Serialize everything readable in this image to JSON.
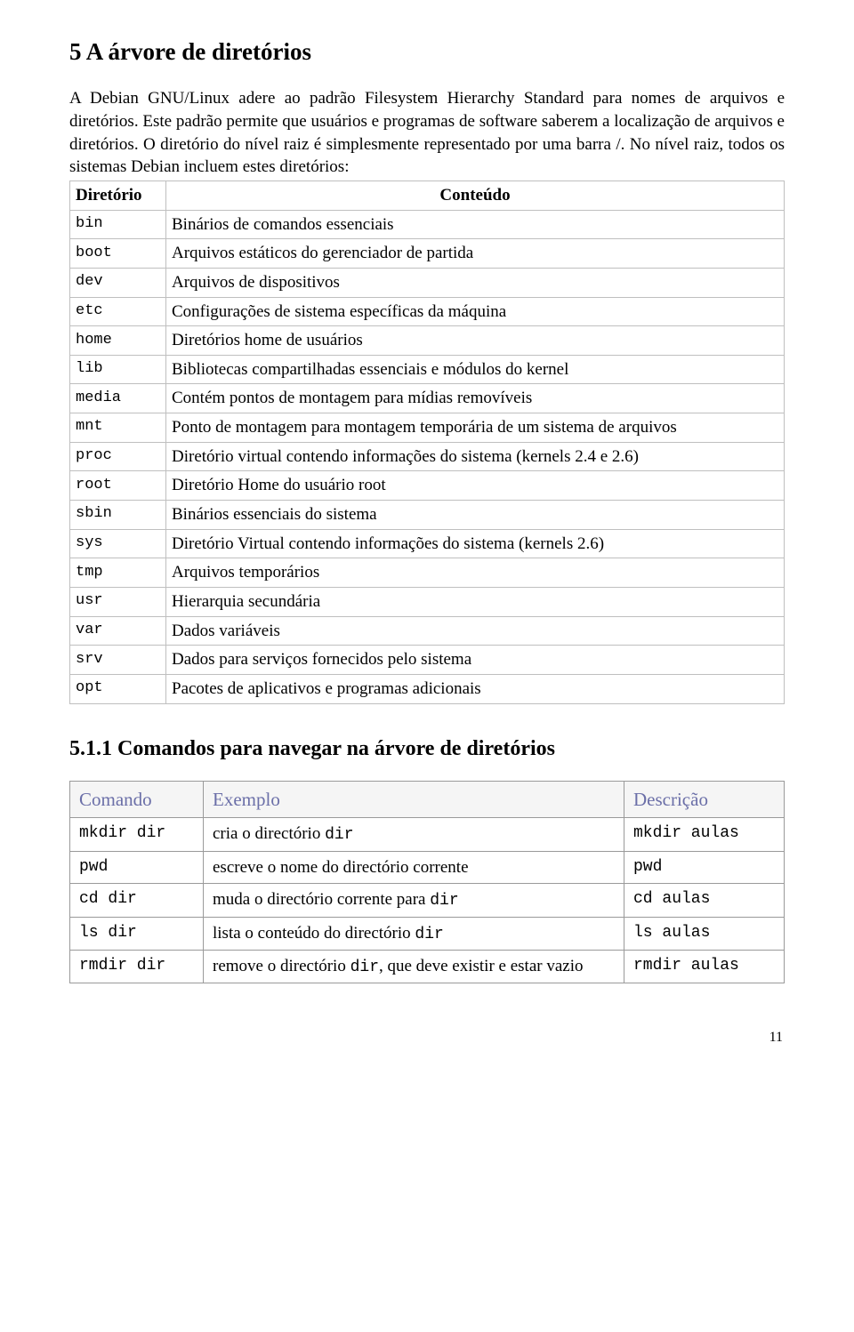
{
  "section": {
    "title": "5 A árvore de diretórios",
    "paragraph": "A Debian GNU/Linux adere ao padrão Filesystem Hierarchy Standard para nomes de arquivos e diretórios. Este padrão permite que usuários e programas de software saberem a localização de arquivos e diretórios. O diretório do nível raiz é simplesmente representado por uma barra /. No nível raiz, todos os sistemas Debian incluem estes diretórios:"
  },
  "dirTable": {
    "headers": {
      "col1": "Diretório",
      "col2": "Conteúdo"
    },
    "rows": [
      {
        "dir": "bin",
        "desc": "Binários de comandos essenciais"
      },
      {
        "dir": "boot",
        "desc": "Arquivos estáticos do gerenciador de partida"
      },
      {
        "dir": "dev",
        "desc": "Arquivos de dispositivos"
      },
      {
        "dir": "etc",
        "desc": "Configurações de sistema específicas da máquina"
      },
      {
        "dir": "home",
        "desc": "Diretórios home de usuários"
      },
      {
        "dir": "lib",
        "desc": "Bibliotecas compartilhadas essenciais e módulos do kernel"
      },
      {
        "dir": "media",
        "desc": "Contém pontos de montagem para mídias removíveis"
      },
      {
        "dir": "mnt",
        "desc": "Ponto de montagem para montagem temporária de um sistema de arquivos"
      },
      {
        "dir": "proc",
        "desc": "Diretório virtual contendo informações do sistema (kernels 2.4 e 2.6)"
      },
      {
        "dir": "root",
        "desc": "Diretório Home do usuário root"
      },
      {
        "dir": "sbin",
        "desc": "Binários essenciais do sistema"
      },
      {
        "dir": "sys",
        "desc": "Diretório Virtual contendo informações do sistema (kernels 2.6)"
      },
      {
        "dir": "tmp",
        "desc": "Arquivos temporários"
      },
      {
        "dir": "usr",
        "desc": "Hierarquia secundária"
      },
      {
        "dir": "var",
        "desc": "Dados variáveis"
      },
      {
        "dir": "srv",
        "desc": "Dados para serviços fornecidos pelo sistema"
      },
      {
        "dir": "opt",
        "desc": "Pacotes de aplicativos e programas adicionais"
      }
    ]
  },
  "subsection": {
    "title": "5.1.1 Comandos para navegar na árvore de diretórios"
  },
  "cmdTable": {
    "headers": {
      "col1": "Comando",
      "col2": "Exemplo",
      "col3": "Descrição"
    },
    "rows": [
      {
        "cmd": "mkdir dir",
        "ex_plain": "cria o directório ",
        "ex_mono": "dir",
        "desc": "mkdir aulas"
      },
      {
        "cmd": "pwd",
        "ex_plain": "escreve o nome do directório corrente",
        "ex_mono": "",
        "desc": "pwd"
      },
      {
        "cmd": "cd dir",
        "ex_plain": "muda o directório corrente para ",
        "ex_mono": "dir",
        "desc": "cd aulas"
      },
      {
        "cmd": "ls dir",
        "ex_plain": "lista o conteúdo do directório ",
        "ex_mono": "dir",
        "desc": "ls aulas"
      },
      {
        "cmd": "rmdir dir",
        "ex_plain": "remove o directório ",
        "ex_mono": "dir",
        "ex_tail": ", que deve existir e estar vazio",
        "desc": "rmdir aulas"
      }
    ]
  },
  "pageNumber": "11"
}
